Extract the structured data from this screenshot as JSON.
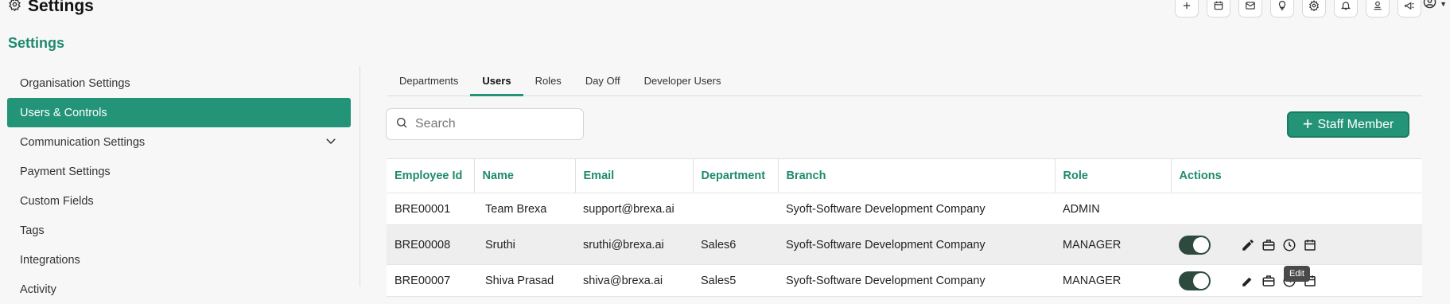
{
  "header": {
    "title": "Settings",
    "icons": [
      "plus-icon",
      "calendar-icon",
      "mail-icon",
      "lightbulb-icon",
      "gear-icon",
      "bell-icon",
      "user-badge-icon",
      "megaphone-icon"
    ],
    "profile_icon": "account-icon"
  },
  "page": {
    "heading": "Settings"
  },
  "sidebar": {
    "items": [
      {
        "label": "Organisation Settings"
      },
      {
        "label": "Users & Controls"
      },
      {
        "label": "Communication Settings"
      },
      {
        "label": "Payment Settings"
      },
      {
        "label": "Custom Fields"
      },
      {
        "label": "Tags"
      },
      {
        "label": "Integrations"
      },
      {
        "label": "Activity"
      }
    ]
  },
  "tabs": [
    {
      "label": "Departments"
    },
    {
      "label": "Users"
    },
    {
      "label": "Roles"
    },
    {
      "label": "Day Off"
    },
    {
      "label": "Developer Users"
    }
  ],
  "search": {
    "placeholder": "Search"
  },
  "add_button": {
    "label": "Staff Member"
  },
  "table": {
    "columns": [
      "Employee Id",
      "Name",
      "Email",
      "Department",
      "Branch",
      "Role",
      "Actions"
    ],
    "rows": [
      {
        "id": "BRE00001",
        "name": "Team Brexa",
        "email": "support@brexa.ai",
        "department": "",
        "branch": "Syoft-Software Development Company",
        "role": "ADMIN"
      },
      {
        "id": "BRE00008",
        "name": "Sruthi",
        "email": "sruthi@brexa.ai",
        "department": "Sales6",
        "branch": "Syoft-Software Development Company",
        "role": "MANAGER"
      },
      {
        "id": "BRE00007",
        "name": "Shiva Prasad",
        "email": "shiva@brexa.ai",
        "department": "Sales5",
        "branch": "Syoft-Software Development Company",
        "role": "MANAGER"
      }
    ]
  },
  "tooltip": {
    "text": "Edit"
  },
  "colors": {
    "accent": "#249478",
    "heading": "#1f8a6e"
  }
}
